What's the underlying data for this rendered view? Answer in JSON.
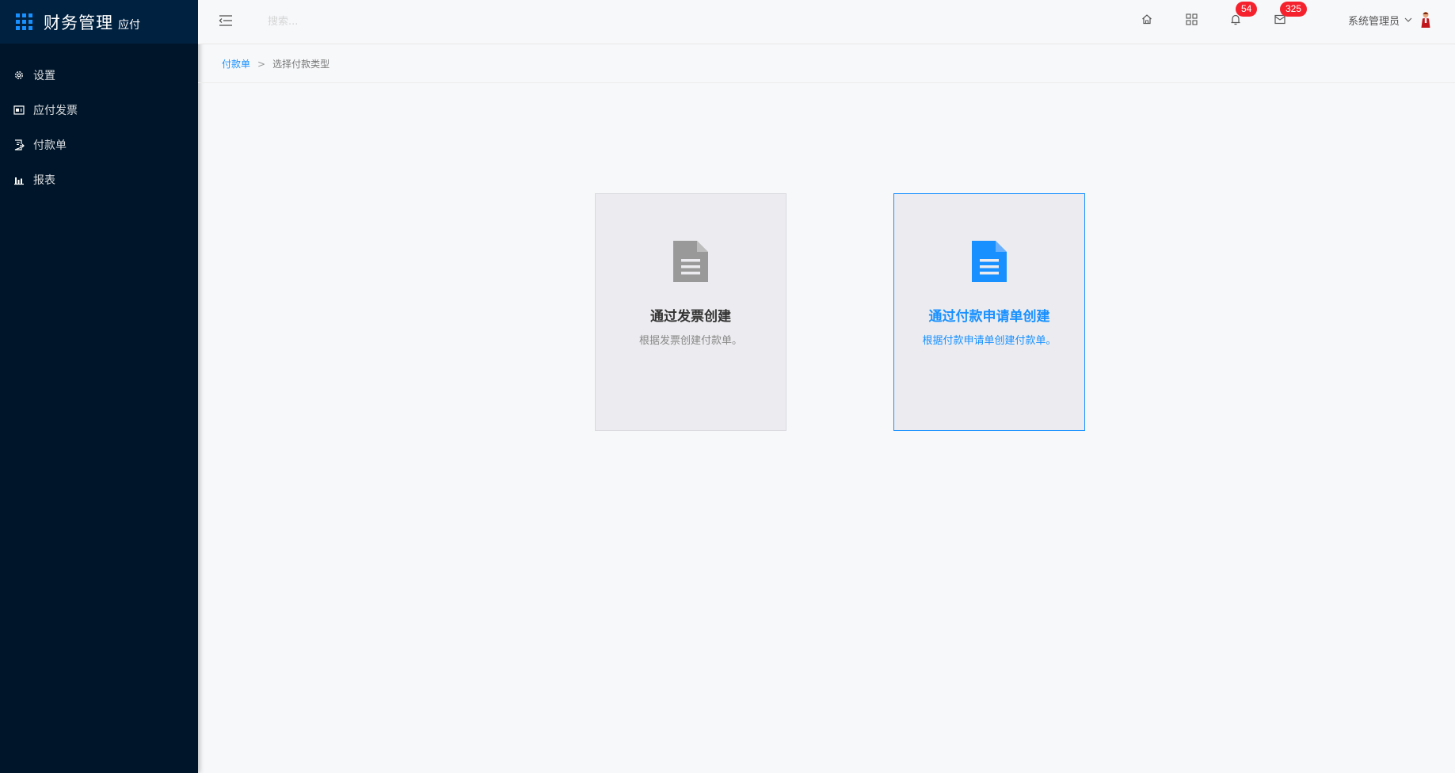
{
  "brand": {
    "title": "财务管理",
    "subtitle": "应付"
  },
  "sidebar": {
    "items": [
      {
        "label": "设置",
        "icon": "gear-icon"
      },
      {
        "label": "应付发票",
        "icon": "invoice-icon"
      },
      {
        "label": "付款单",
        "icon": "payment-doc-icon"
      },
      {
        "label": "报表",
        "icon": "bar-chart-icon"
      }
    ]
  },
  "header": {
    "search_placeholder": "搜索...",
    "notifications_count": "54",
    "messages_count": "325",
    "user_name": "系统管理员"
  },
  "breadcrumb": {
    "parent": "付款单",
    "separator": ">",
    "current": "选择付款类型"
  },
  "cards": [
    {
      "title": "通过发票创建",
      "desc": "根据发票创建付款单。",
      "icon_color": "#999999"
    },
    {
      "title": "通过付款申请单创建",
      "desc": "根据付款申请单创建付款单。",
      "icon_color": "#1890ff"
    }
  ],
  "colors": {
    "sidebar_bg": "#001529",
    "accent": "#1890ff",
    "badge": "#f5222d"
  }
}
